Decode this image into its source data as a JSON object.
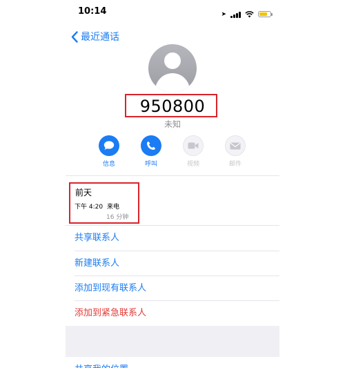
{
  "status": {
    "time": "10:14"
  },
  "nav": {
    "back_label": "最近通话"
  },
  "contact": {
    "number": "950800",
    "subtitle": "未知"
  },
  "actions": [
    {
      "label": "信息",
      "icon": "message-icon"
    },
    {
      "label": "呼叫",
      "icon": "phone-icon"
    },
    {
      "label": "视频",
      "icon": "video-icon"
    },
    {
      "label": "邮件",
      "icon": "mail-icon"
    }
  ],
  "recent": {
    "day": "前天",
    "time": "下午 4:20",
    "type": "来电",
    "duration": "16 分钟"
  },
  "menu": [
    {
      "label": "共享联系人"
    },
    {
      "label": "新建联系人"
    },
    {
      "label": "添加到现有联系人"
    },
    {
      "label": "添加到紧急联系人"
    }
  ],
  "partial_row": "共享我的位置",
  "colors": {
    "accent": "#1b7cf3",
    "danger": "#e53935",
    "highlight_box": "#d8222a"
  }
}
